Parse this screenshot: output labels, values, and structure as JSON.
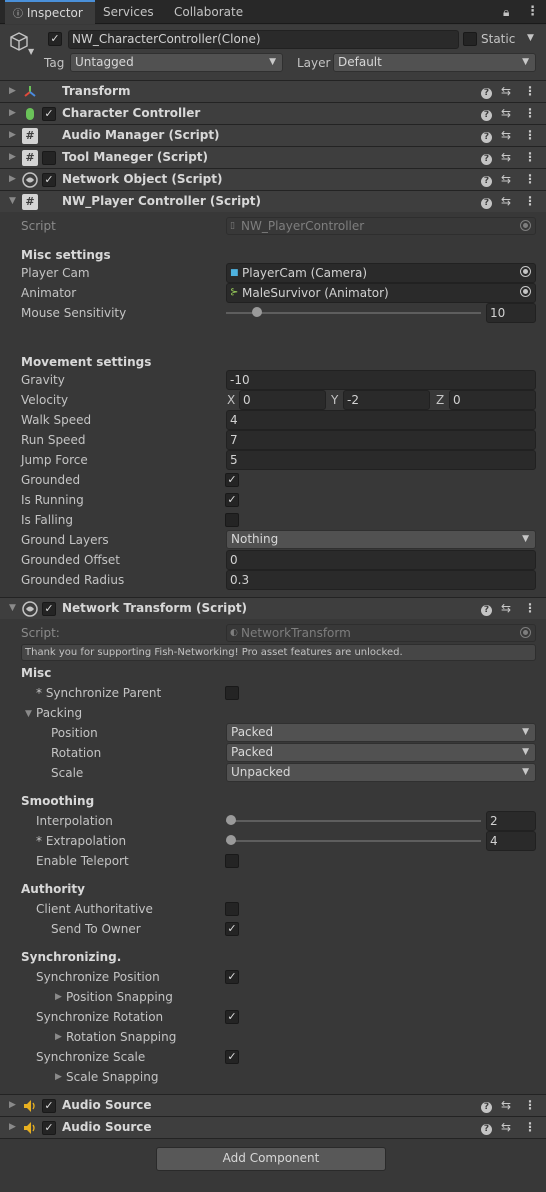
{
  "tabs": {
    "inspector": "Inspector",
    "services": "Services",
    "collaborate": "Collaborate"
  },
  "object": {
    "active": true,
    "name": "NW_CharacterController(Clone)",
    "static_label": "Static",
    "tag_label": "Tag",
    "tag_value": "Untagged",
    "layer_label": "Layer",
    "layer_value": "Default"
  },
  "components": {
    "transform": "Transform",
    "character_controller": "Character Controller",
    "audio_manager": "Audio Manager (Script)",
    "tool_manager": "Tool Maneger (Script)",
    "network_object": "Network Object (Script)",
    "player_controller": "NW_Player Controller (Script)",
    "network_transform": "Network Transform (Script)",
    "audio_source_1": "Audio Source",
    "audio_source_2": "Audio Source"
  },
  "player_controller": {
    "script_label": "Script",
    "script_value": "NW_PlayerController",
    "misc_header": "Misc settings",
    "player_cam_label": "Player Cam",
    "player_cam_value": "PlayerCam (Camera)",
    "animator_label": "Animator",
    "animator_value": "MaleSurvivor (Animator)",
    "mouse_sens_label": "Mouse Sensitivity",
    "mouse_sens_value": "10",
    "mouse_sens_fraction": 0.1,
    "movement_header": "Movement settings",
    "gravity_label": "Gravity",
    "gravity_value": "-10",
    "velocity_label": "Velocity",
    "x_label": "X",
    "vx": "0",
    "y_label": "Y",
    "vy": "-2",
    "z_label": "Z",
    "vz": "0",
    "walk_label": "Walk Speed",
    "walk_value": "4",
    "run_label": "Run Speed",
    "run_value": "7",
    "jump_label": "Jump Force",
    "jump_value": "5",
    "grounded_label": "Grounded",
    "grounded": true,
    "running_label": "Is Running",
    "running": true,
    "falling_label": "Is Falling",
    "falling": false,
    "ground_layers_label": "Ground Layers",
    "ground_layers_value": "Nothing",
    "grounded_offset_label": "Grounded Offset",
    "grounded_offset_value": "0",
    "grounded_radius_label": "Grounded Radius",
    "grounded_radius_value": "0.3"
  },
  "network_transform": {
    "script_label": "Script:",
    "script_value": "NetworkTransform",
    "notice": "Thank you for supporting Fish-Networking! Pro asset features are unlocked.",
    "misc_header": "Misc",
    "sync_parent_label": "* Synchronize Parent",
    "packing_label": "Packing",
    "position_label": "Position",
    "position_value": "Packed",
    "rotation_label": "Rotation",
    "rotation_value": "Packed",
    "scale_label": "Scale",
    "scale_value": "Unpacked",
    "smoothing_header": "Smoothing",
    "interp_label": "Interpolation",
    "interp_value": "2",
    "extrap_label": "* Extrapolation",
    "extrap_value": "4",
    "teleport_label": "Enable Teleport",
    "authority_header": "Authority",
    "client_auth_label": "Client Authoritative",
    "send_owner_label": "Send To Owner",
    "sync_header": "Synchronizing.",
    "sync_pos_label": "Synchronize Position",
    "pos_snap_label": "Position Snapping",
    "sync_rot_label": "Synchronize Rotation",
    "rot_snap_label": "Rotation Snapping",
    "sync_scale_label": "Synchronize Scale",
    "scale_snap_label": "Scale Snapping"
  },
  "add_component": "Add Component"
}
